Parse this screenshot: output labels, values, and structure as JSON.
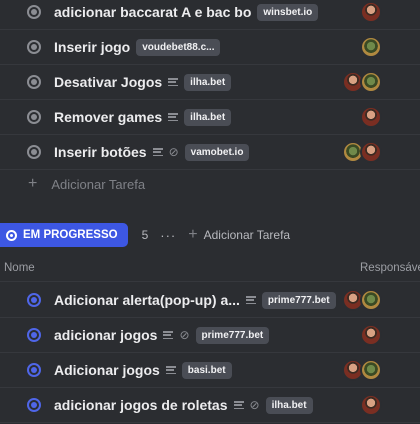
{
  "todo_tasks": [
    {
      "name": "adicionar baccarat A e bac bo",
      "tag": "winsbet.io",
      "desc": false,
      "clip": false,
      "avatars": [
        "man"
      ]
    },
    {
      "name": "Inserir jogo",
      "tag": "voudebet88.c...",
      "desc": false,
      "clip": false,
      "avatars": [
        "monster"
      ]
    },
    {
      "name": "Desativar Jogos",
      "tag": "ilha.bet",
      "desc": true,
      "clip": false,
      "avatars": [
        "man",
        "monster"
      ]
    },
    {
      "name": "Remover games",
      "tag": "ilha.bet",
      "desc": true,
      "clip": false,
      "avatars": [
        "man"
      ]
    },
    {
      "name": "Inserir botões",
      "tag": "vamobet.io",
      "desc": true,
      "clip": true,
      "avatars": [
        "monster",
        "man"
      ]
    }
  ],
  "add_task_label": "Adicionar Tarefa",
  "group": {
    "status_label": "EM PROGRESSO",
    "count": "5",
    "more_label": "···",
    "add_task_label": "Adicionar Tarefa"
  },
  "columns": {
    "name": "Nome",
    "assignee": "Responsáve"
  },
  "progress_tasks": [
    {
      "name": "Adicionar alerta(pop-up) a...",
      "tag": "prime777.bet",
      "desc": true,
      "clip": false,
      "avatars": [
        "man",
        "monster"
      ]
    },
    {
      "name": "adicionar jogos",
      "tag": "prime777.bet",
      "desc": true,
      "clip": true,
      "avatars": [
        "man"
      ]
    },
    {
      "name": "Adicionar jogos",
      "tag": "basi.bet",
      "desc": true,
      "clip": false,
      "avatars": [
        "man",
        "monster"
      ]
    },
    {
      "name": "adicionar jogos de roletas",
      "tag": "ilha.bet",
      "desc": true,
      "clip": true,
      "avatars": [
        "man"
      ]
    }
  ],
  "colors": {
    "background": "#2b2d31",
    "progress_accent": "#3d57e3",
    "tag_bg": "#4a4d55"
  }
}
